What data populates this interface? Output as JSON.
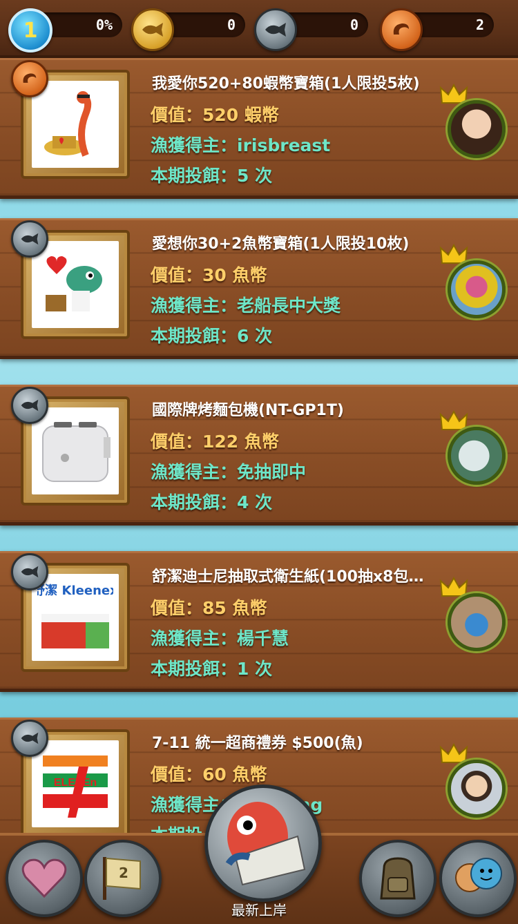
{
  "status": {
    "level": "1",
    "level_progress": "0%",
    "level_progress_value": 0,
    "gold_coins": "0",
    "fish_coins": "0",
    "shrimp_coins": "2"
  },
  "prizes": [
    {
      "title": "我愛你520+80蝦幣寶箱(1人限投5枚)",
      "value_text": "價值：520 蝦幣",
      "winner_text": "漁獲得主：irisbreast",
      "bait_text": "本期投餌：5 次",
      "currency_icon": "shrimp-coin-icon",
      "image_icon": "shrimp-mascot-treasure-icon"
    },
    {
      "title": "愛想你30+2魚幣寶箱(1人限投10枚)",
      "value_text": "價值：30 魚幣",
      "winner_text": "漁獲得主：老船長中大獎",
      "bait_text": "本期投餌：6 次",
      "currency_icon": "fish-coin-icon",
      "image_icon": "fish-mascot-hearts-icon"
    },
    {
      "title": "國際牌烤麵包機(NT-GP1T)",
      "value_text": "價值：122 魚幣",
      "winner_text": "漁獲得主：免抽即中",
      "bait_text": "本期投餌：4 次",
      "currency_icon": "fish-coin-icon",
      "image_icon": "toaster-icon"
    },
    {
      "title": "舒潔迪士尼抽取式衛生紙(100抽x8包…",
      "value_text": "價值：85 魚幣",
      "winner_text": "漁獲得主：楊千慧",
      "bait_text": "本期投餌：1 次",
      "currency_icon": "fish-coin-icon",
      "image_icon": "tissue-box-icon",
      "image_text": "舒潔 Kleenex"
    },
    {
      "title": "7-11 統一超商禮券 $500(魚)",
      "value_text": "價值：60 魚幣",
      "winner_text": "漁獲得主：",
      "winner_tail": "ing",
      "bait_text": "本期投",
      "currency_icon": "fish-coin-icon",
      "image_icon": "seven-eleven-logo-icon",
      "image_text": "ELEVEn"
    }
  ],
  "nav": {
    "news_label": "最新上岸",
    "buttons": [
      "heart-icon",
      "ranking-flag-icon",
      "news-fish-icon",
      "backpack-icon",
      "friends-icon"
    ]
  },
  "colors": {
    "wood": "#8a4e26",
    "value_text": "#ffcf6a",
    "winner_text": "#6ee6c8",
    "sea": "#7fd3e4"
  }
}
